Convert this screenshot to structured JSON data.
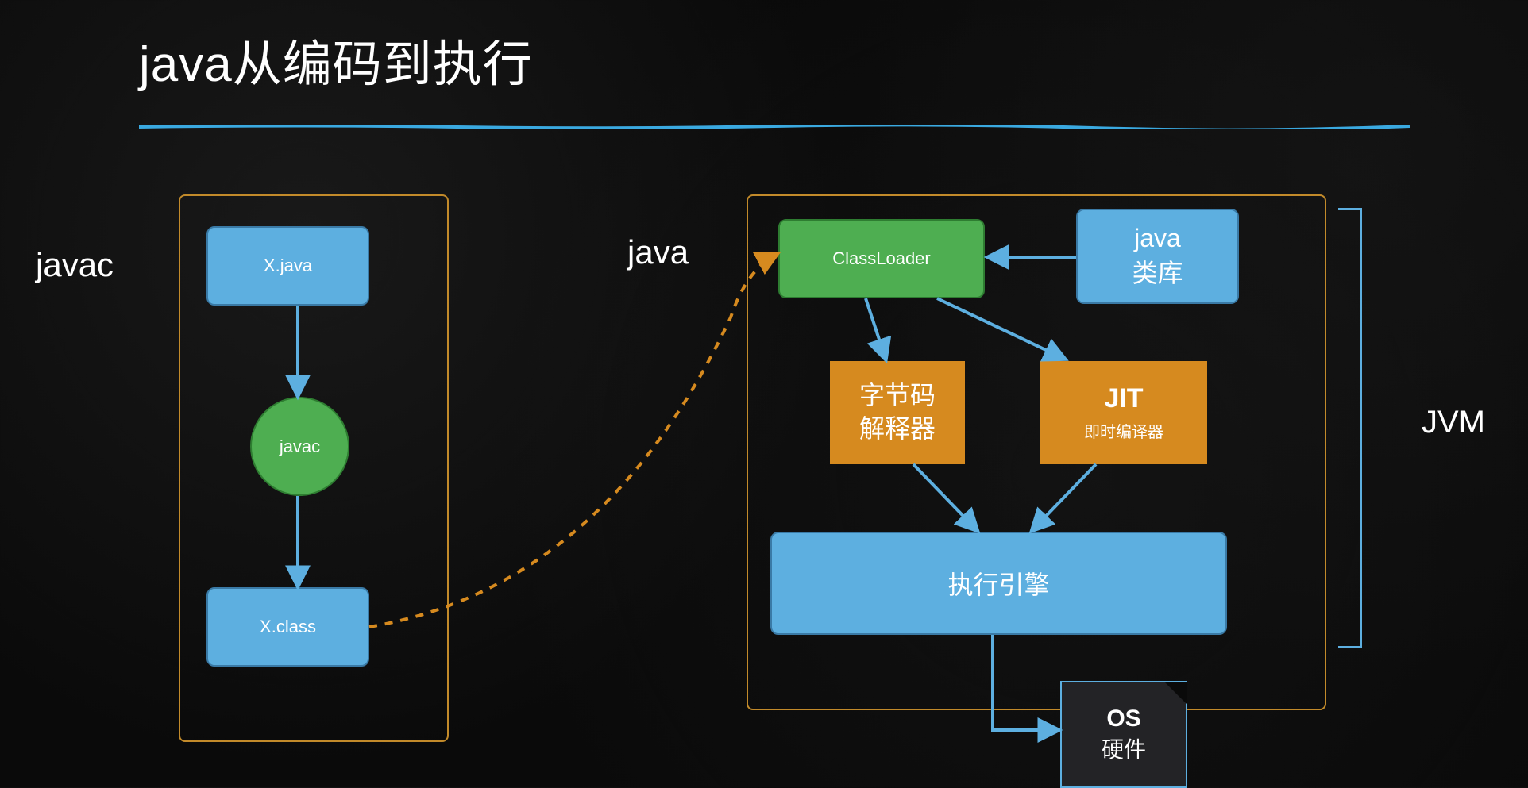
{
  "title": "java从编码到执行",
  "labels": {
    "javac": "javac",
    "java": "java",
    "jvm": "JVM"
  },
  "nodes": {
    "xjava": "X.java",
    "javac_circle": "javac",
    "xclass": "X.class",
    "classloader": "ClassLoader",
    "javalib_line1": "java",
    "javalib_line2": "类库",
    "bytecode_line1": "字节码",
    "bytecode_line2": "解释器",
    "jit_title": "JIT",
    "jit_sub": "即时编译器",
    "engine": "执行引擎",
    "os_line1": "OS",
    "os_line2": "硬件"
  },
  "colors": {
    "blue": "#5dafe0",
    "green": "#4eae51",
    "orange": "#d68a1f",
    "border_gold": "#c28a2a"
  },
  "diagram": {
    "edges": [
      {
        "from": "X.java",
        "to": "javac",
        "style": "solid"
      },
      {
        "from": "javac",
        "to": "X.class",
        "style": "solid"
      },
      {
        "from": "X.class",
        "to": "ClassLoader",
        "style": "dashed"
      },
      {
        "from": "java类库",
        "to": "ClassLoader",
        "style": "solid"
      },
      {
        "from": "ClassLoader",
        "to": "字节码解释器",
        "style": "solid"
      },
      {
        "from": "ClassLoader",
        "to": "JIT即时编译器",
        "style": "solid"
      },
      {
        "from": "字节码解释器",
        "to": "执行引擎",
        "style": "solid"
      },
      {
        "from": "JIT即时编译器",
        "to": "执行引擎",
        "style": "solid"
      },
      {
        "from": "执行引擎",
        "to": "OS硬件",
        "style": "solid"
      }
    ]
  }
}
